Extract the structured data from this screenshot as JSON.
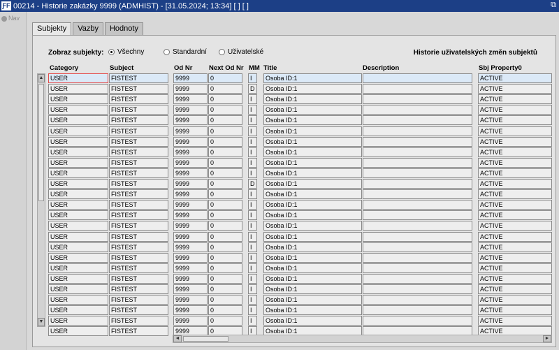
{
  "window": {
    "app_icon": "ƑF",
    "title": "00214 - Historie zakázky 9999 (ADMHIST) - [31.05.2024; 13:34]  [ ]  [ ]",
    "restore_icon": "⧉"
  },
  "nav": {
    "label": "Nav"
  },
  "tabs": [
    {
      "label": "Subjekty",
      "active": true
    },
    {
      "label": "Vazby",
      "active": false
    },
    {
      "label": "Hodnoty",
      "active": false
    }
  ],
  "filter": {
    "label": "Zobraz subjekty:",
    "options": [
      {
        "label": "Všechny",
        "selected": true
      },
      {
        "label": "Standardní",
        "selected": false
      },
      {
        "label": "Uživatelské",
        "selected": false
      }
    ]
  },
  "history_title": "Historie uživatelských změn subjektů",
  "columns": [
    "Category",
    "Subject",
    "Od Nr",
    "Next Od Nr",
    "MM",
    "Title",
    "Description",
    "Sbj Property0"
  ],
  "rows": [
    [
      "USER",
      "FISTEST",
      "9999",
      "0",
      "I",
      "Osoba ID:1",
      "",
      "ACTIVE"
    ],
    [
      "USER",
      "FISTEST",
      "9999",
      "0",
      "D",
      "Osoba ID:1",
      "",
      "ACTIVE"
    ],
    [
      "USER",
      "FISTEST",
      "9999",
      "0",
      "I",
      "Osoba ID:1",
      "",
      "ACTIVE"
    ],
    [
      "USER",
      "FISTEST",
      "9999",
      "0",
      "I",
      "Osoba ID:1",
      "",
      "ACTIVE"
    ],
    [
      "USER",
      "FISTEST",
      "9999",
      "0",
      "I",
      "Osoba ID:1",
      "",
      "ACTIVE"
    ],
    [
      "USER",
      "FISTEST",
      "9999",
      "0",
      "I",
      "Osoba ID:1",
      "",
      "ACTIVE"
    ],
    [
      "USER",
      "FISTEST",
      "9999",
      "0",
      "I",
      "Osoba ID:1",
      "",
      "ACTIVE"
    ],
    [
      "USER",
      "FISTEST",
      "9999",
      "0",
      "I",
      "Osoba ID:1",
      "",
      "ACTIVE"
    ],
    [
      "USER",
      "FISTEST",
      "9999",
      "0",
      "I",
      "Osoba ID:1",
      "",
      "ACTIVE"
    ],
    [
      "USER",
      "FISTEST",
      "9999",
      "0",
      "I",
      "Osoba ID:1",
      "",
      "ACTIVE"
    ],
    [
      "USER",
      "FISTEST",
      "9999",
      "0",
      "D",
      "Osoba ID:1",
      "",
      "ACTIVE"
    ],
    [
      "USER",
      "FISTEST",
      "9999",
      "0",
      "I",
      "Osoba ID:1",
      "",
      "ACTIVE"
    ],
    [
      "USER",
      "FISTEST",
      "9999",
      "0",
      "I",
      "Osoba ID:1",
      "",
      "ACTIVE"
    ],
    [
      "USER",
      "FISTEST",
      "9999",
      "0",
      "I",
      "Osoba ID:1",
      "",
      "ACTIVE"
    ],
    [
      "USER",
      "FISTEST",
      "9999",
      "0",
      "I",
      "Osoba ID:1",
      "",
      "ACTIVE"
    ],
    [
      "USER",
      "FISTEST",
      "9999",
      "0",
      "I",
      "Osoba ID:1",
      "",
      "ACTIVE"
    ],
    [
      "USER",
      "FISTEST",
      "9999",
      "0",
      "I",
      "Osoba ID:1",
      "",
      "ACTIVE"
    ],
    [
      "USER",
      "FISTEST",
      "9999",
      "0",
      "I",
      "Osoba ID:1",
      "",
      "ACTIVE"
    ],
    [
      "USER",
      "FISTEST",
      "9999",
      "0",
      "I",
      "Osoba ID:1",
      "",
      "ACTIVE"
    ],
    [
      "USER",
      "FISTEST",
      "9999",
      "0",
      "I",
      "Osoba ID:1",
      "",
      "ACTIVE"
    ],
    [
      "USER",
      "FISTEST",
      "9999",
      "0",
      "I",
      "Osoba ID:1",
      "",
      "ACTIVE"
    ],
    [
      "USER",
      "FISTEST",
      "9999",
      "0",
      "I",
      "Osoba ID:1",
      "",
      "ACTIVE"
    ],
    [
      "USER",
      "FISTEST",
      "9999",
      "0",
      "I",
      "Osoba ID:1",
      "",
      "ACTIVE"
    ],
    [
      "USER",
      "FISTEST",
      "9999",
      "0",
      "I",
      "Osoba ID:1",
      "",
      "ACTIVE"
    ],
    [
      "USER",
      "FISTEST",
      "9999",
      "0",
      "I",
      "Osoba ID:1",
      "",
      "ACTIVE"
    ]
  ],
  "selected_row": 0,
  "scroll_icons": {
    "up": "▲",
    "down": "▼",
    "left": "◄",
    "right": "►"
  }
}
